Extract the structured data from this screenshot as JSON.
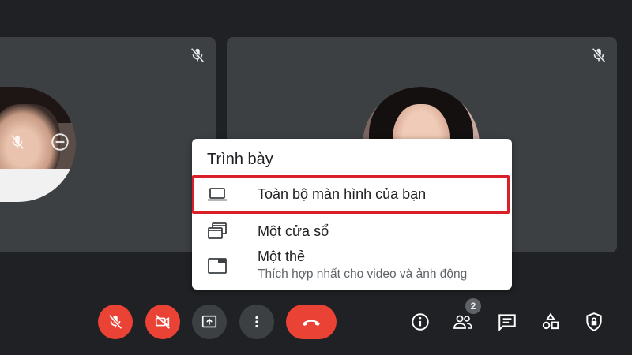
{
  "participants": [
    {
      "name": "participant-left",
      "muted": true
    },
    {
      "name": "participant-right",
      "muted": true
    }
  ],
  "present_menu": {
    "title": "Trình bày",
    "items": [
      {
        "icon": "laptop-icon",
        "label": "Toàn bộ màn hình của bạn",
        "selected": true
      },
      {
        "icon": "window-icon",
        "label": "Một cửa sổ"
      },
      {
        "icon": "tab-icon",
        "label": "Một thẻ",
        "sublabel": "Thích hợp nhất cho video và ảnh động"
      }
    ]
  },
  "controls": {
    "mic": {
      "icon": "mic-off-icon",
      "state": "off"
    },
    "camera": {
      "icon": "camera-off-icon",
      "state": "off"
    },
    "present": {
      "icon": "present-screen-icon"
    },
    "more": {
      "icon": "more-vert-icon"
    },
    "hangup": {
      "icon": "phone-hangup-icon"
    }
  },
  "right_controls": {
    "info": {
      "icon": "info-icon"
    },
    "people": {
      "icon": "people-icon",
      "count": "2"
    },
    "chat": {
      "icon": "chat-icon"
    },
    "activities": {
      "icon": "activities-icon"
    },
    "host_controls": {
      "icon": "shield-lock-icon"
    }
  },
  "colors": {
    "background": "#202124",
    "tile": "#3c4043",
    "danger": "#ea4335",
    "highlight_border": "#d92028"
  }
}
